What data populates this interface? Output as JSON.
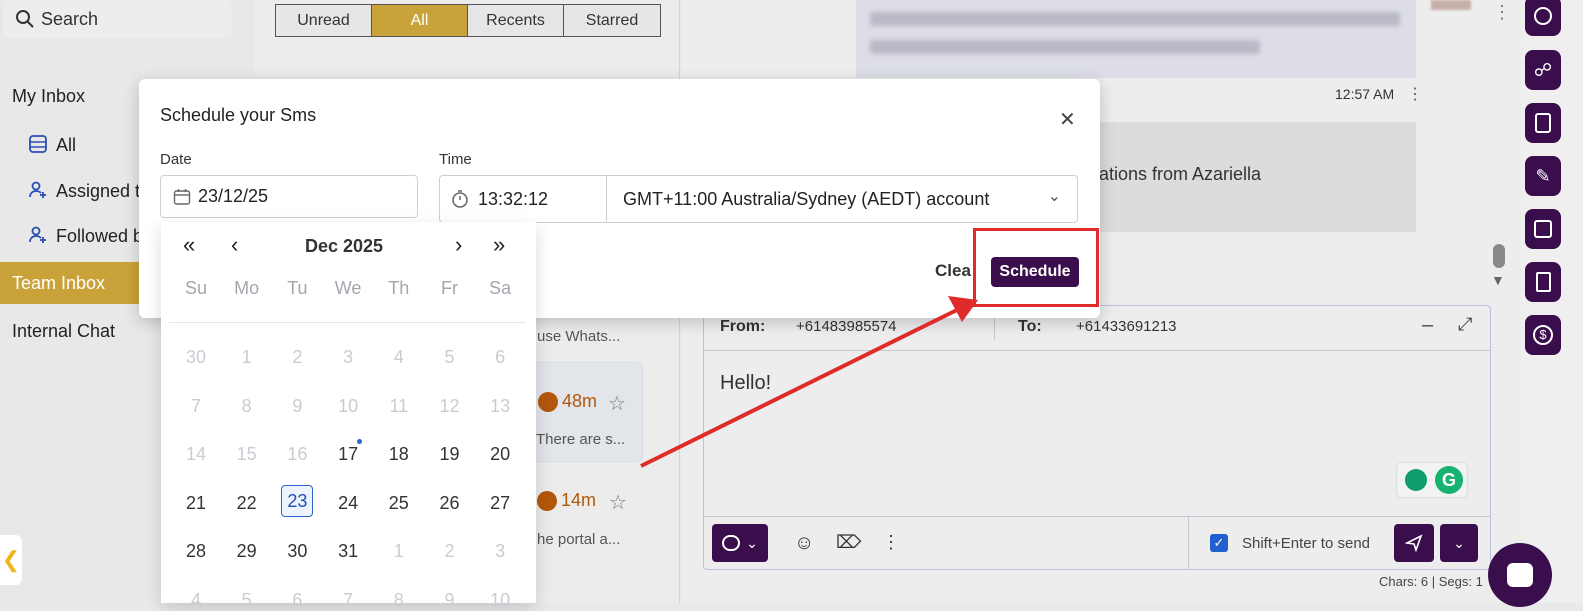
{
  "sidebar": {
    "search": "Search",
    "my_inbox": "My Inbox",
    "all": "All",
    "assigned": "Assigned to",
    "followed": "Followed b",
    "team_inbox": "Team Inbox",
    "internal_chat": "Internal Chat"
  },
  "tabs": [
    "Unread",
    "All",
    "Recents",
    "Starred"
  ],
  "conversations": [
    {
      "snippet": "use Whats..."
    },
    {
      "timer": "48m",
      "snippet": "There are s..."
    },
    {
      "timer": "14m",
      "snippet": "he portal a..."
    }
  ],
  "chat": {
    "time": "12:57 AM",
    "partial_text": "ations from Azariella",
    "from_label": "From:",
    "from_value": "+61483985574",
    "to_label": "To:",
    "to_value": "+61433691213",
    "message": "Hello!",
    "shift_enter": "Shift+Enter to send",
    "chars": "Chars: 6 | Segs: 1"
  },
  "modal": {
    "title": "Schedule your Sms",
    "date_label": "Date",
    "date_value": "23/12/25",
    "time_label": "Time",
    "time_value": "13:32:12",
    "timezone": "GMT+11:00 Australia/Sydney (AEDT) account",
    "clear": "Clea",
    "schedule": "Schedule"
  },
  "calendar": {
    "month": "Dec 2025",
    "dows": [
      "Su",
      "Mo",
      "Tu",
      "We",
      "Th",
      "Fr",
      "Sa"
    ],
    "weeks": [
      [
        "30",
        "1",
        "2",
        "3",
        "4",
        "5",
        "6"
      ],
      [
        "7",
        "8",
        "9",
        "10",
        "11",
        "12",
        "13"
      ],
      [
        "14",
        "15",
        "16",
        "17",
        "18",
        "19",
        "20"
      ],
      [
        "21",
        "22",
        "23",
        "24",
        "25",
        "26",
        "27"
      ],
      [
        "28",
        "29",
        "30",
        "31",
        "1",
        "2",
        "3"
      ],
      [
        "4",
        "5",
        "6",
        "7",
        "8",
        "9",
        "10"
      ]
    ],
    "muted": [
      [
        1,
        1,
        1,
        1,
        1,
        1,
        1
      ],
      [
        1,
        1,
        1,
        1,
        1,
        1,
        1
      ],
      [
        1,
        1,
        1,
        0,
        0,
        0,
        0
      ],
      [
        0,
        0,
        0,
        0,
        0,
        0,
        0
      ],
      [
        0,
        0,
        0,
        0,
        1,
        1,
        1
      ],
      [
        1,
        1,
        1,
        1,
        1,
        1,
        1
      ]
    ],
    "selected": "23",
    "today": "17"
  },
  "colors": {
    "accent": "#3a0d4d",
    "gold": "#c9a33a",
    "red": "#e02b2b"
  }
}
